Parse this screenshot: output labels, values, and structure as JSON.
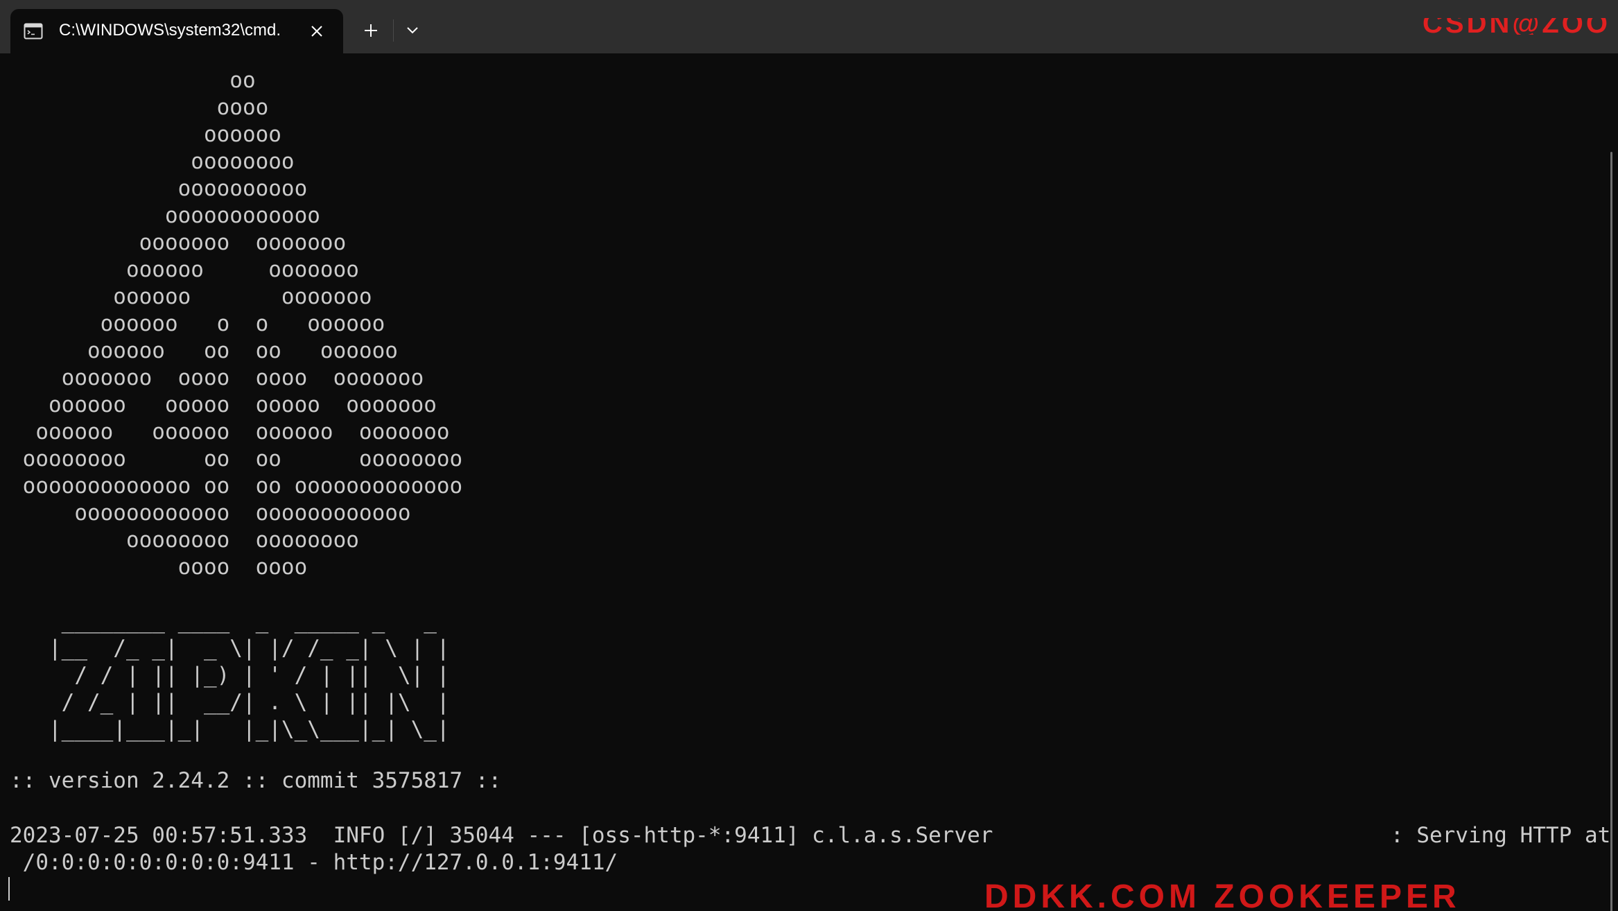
{
  "window": {
    "tab_title": "C:\\WINDOWS\\system32\\cmd.",
    "tab_icon": "terminal-icon",
    "close_icon": "close-icon",
    "new_tab_icon": "plus-icon",
    "dropdown_icon": "chevron-down-icon"
  },
  "terminal": {
    "ascii_logo": "                 oo\n                oooo\n               oooooo\n              oooooooo\n             oooooooooo\n            oooooooooooo\n          ooooooo  ooooooo\n         oooooo     ooooooo\n        oooooo       ooooooo\n       oooooo   o  o   oooooo\n      oooooo   oo  oo   oooooo\n    ooooooo  oooo  oooo  ooooooo\n   oooooo   ooooo  ooooo  ooooooo\n  oooooo   oooooo  oooooo  ooooooo\n oooooooo      oo  oo      oooooooo\n ooooooooooooo oo  oo ooooooooooooo\n     oooooooooooo  oooooooooooo\n         oooooooo  oooooooo\n             oooo  oooo\n\n    ________ ____  _  _____ _   _\n   |__  /_ _|  _ \\| |/ /_ _| \\ | |\n     / / | || |_) | ' / | ||  \\| |\n    / /_ | ||  __/| . \\ | || |\\  |\n   |____|___|_|   |_|\\_\\___|_| \\_|",
    "version_line": ":: version 2.24.2 :: commit 3575817 ::",
    "log_line_1": "2023-07-25 00:57:51.333  INFO [/] 35044 --- [oss-http-*:9411] c.l.a.s.Server",
    "log_line_1_tail": ": Serving HTTP at",
    "log_line_2": " /0:0:0:0:0:0:0:0:9411 - http://127.0.0.1:9411/"
  },
  "colors": {
    "background": "#0c0c0c",
    "foreground": "#cccccc",
    "titlebar": "#2e2e2e",
    "watermark": "#e02020"
  }
}
